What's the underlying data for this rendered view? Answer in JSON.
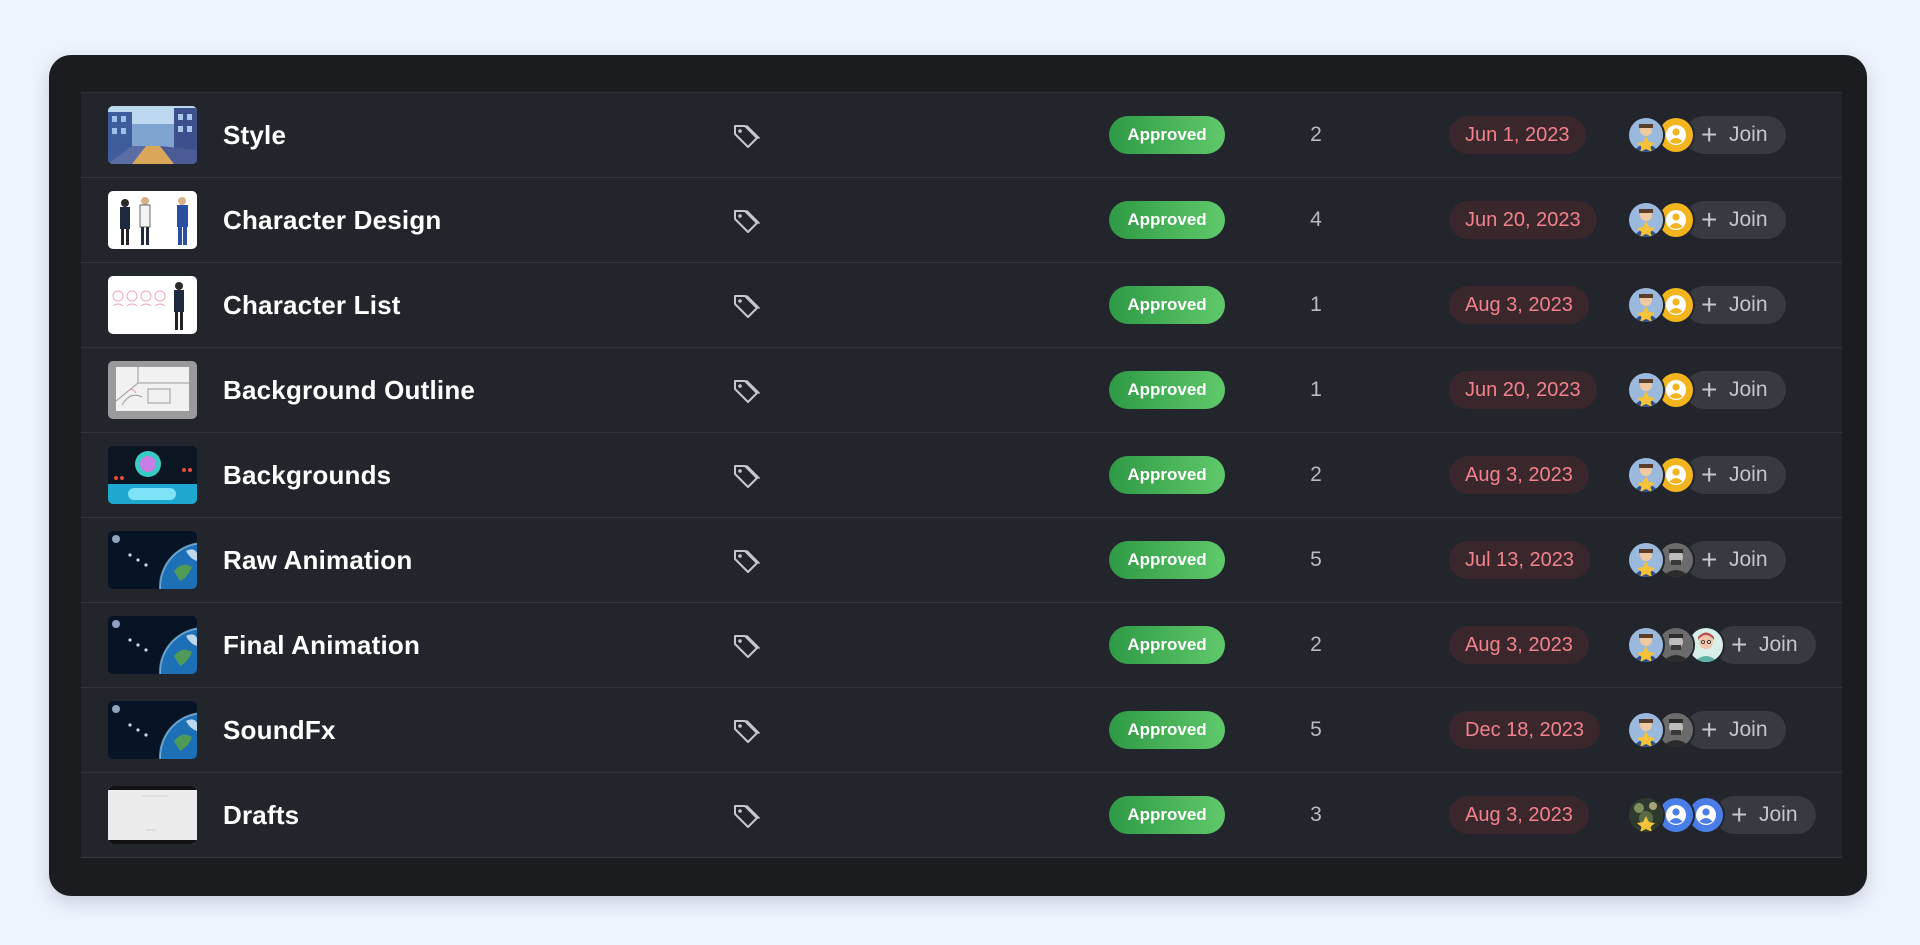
{
  "status_color_start": "#2e9a45",
  "status_color_end": "#5fc96a",
  "date_text_color": "#f2828c",
  "rows": [
    {
      "name": "Style",
      "status": "Approved",
      "count": "2",
      "date": "Jun 1, 2023",
      "join": "Join",
      "thumb": "street-scene",
      "avatars": [
        "badge-avatar",
        "user-placeholder-yellow"
      ]
    },
    {
      "name": "Character Design",
      "status": "Approved",
      "count": "4",
      "date": "Jun 20, 2023",
      "join": "Join",
      "thumb": "character-lineup",
      "avatars": [
        "badge-avatar",
        "user-placeholder-yellow"
      ]
    },
    {
      "name": "Character List",
      "status": "Approved",
      "count": "1",
      "date": "Aug 3, 2023",
      "join": "Join",
      "thumb": "character-sketches",
      "avatars": [
        "badge-avatar",
        "user-placeholder-yellow"
      ]
    },
    {
      "name": "Background Outline",
      "status": "Approved",
      "count": "1",
      "date": "Jun 20, 2023",
      "join": "Join",
      "thumb": "room-outline",
      "avatars": [
        "badge-avatar",
        "user-placeholder-yellow"
      ]
    },
    {
      "name": "Backgrounds",
      "status": "Approved",
      "count": "2",
      "date": "Aug 3, 2023",
      "join": "Join",
      "thumb": "scifi-orb",
      "avatars": [
        "badge-avatar",
        "user-placeholder-yellow"
      ]
    },
    {
      "name": "Raw Animation",
      "status": "Approved",
      "count": "5",
      "date": "Jul 13, 2023",
      "join": "Join",
      "thumb": "earth-space",
      "avatars": [
        "badge-avatar",
        "photo-man-gray"
      ]
    },
    {
      "name": "Final Animation",
      "status": "Approved",
      "count": "2",
      "date": "Aug 3, 2023",
      "join": "Join",
      "thumb": "earth-space",
      "avatars": [
        "badge-avatar",
        "photo-man-gray",
        "illustrated-person"
      ]
    },
    {
      "name": "SoundFx",
      "status": "Approved",
      "count": "5",
      "date": "Dec 18, 2023",
      "join": "Join",
      "thumb": "earth-space",
      "avatars": [
        "badge-avatar",
        "photo-man-gray"
      ]
    },
    {
      "name": "Drafts",
      "status": "Approved",
      "count": "3",
      "date": "Aug 3, 2023",
      "join": "Join",
      "thumb": "blank-draft",
      "avatars": [
        "photo-badge-dark",
        "user-placeholder-blue",
        "user-placeholder-blue"
      ]
    }
  ]
}
